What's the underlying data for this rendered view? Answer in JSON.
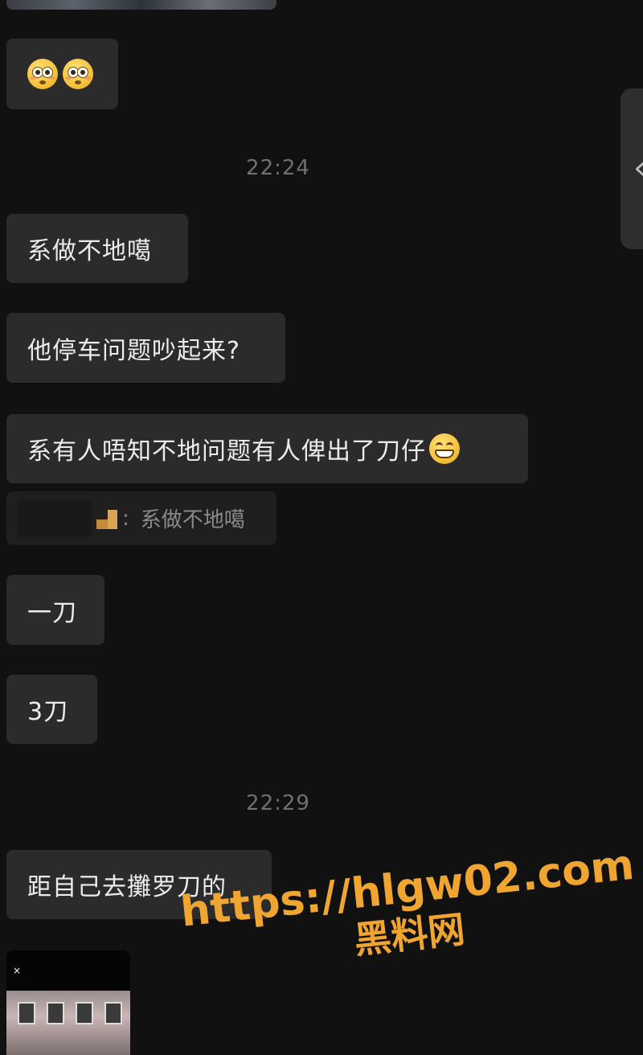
{
  "timestamps": [
    "22:24",
    "22:29"
  ],
  "messages": {
    "m1": "系做不地噶",
    "m2": "他停车问题吵起来?",
    "m3": "系有人唔知不地问题有人俾出了刀仔",
    "m4": "一刀",
    "m5": "3刀",
    "m6": "距自己去攤罗刀的"
  },
  "quote": {
    "text": "系做不地噶"
  },
  "emojis": {
    "first_bubble": [
      "flushed-face",
      "flushed-face"
    ],
    "m3_trailing": "grinning-face"
  },
  "image_close_symbol": "×",
  "watermark": {
    "url": "https://hlgw02.com",
    "site": "黑料网"
  },
  "colors": {
    "background": "#111111",
    "bubble": "#2b2b2b",
    "watermark": "#f0a531"
  }
}
